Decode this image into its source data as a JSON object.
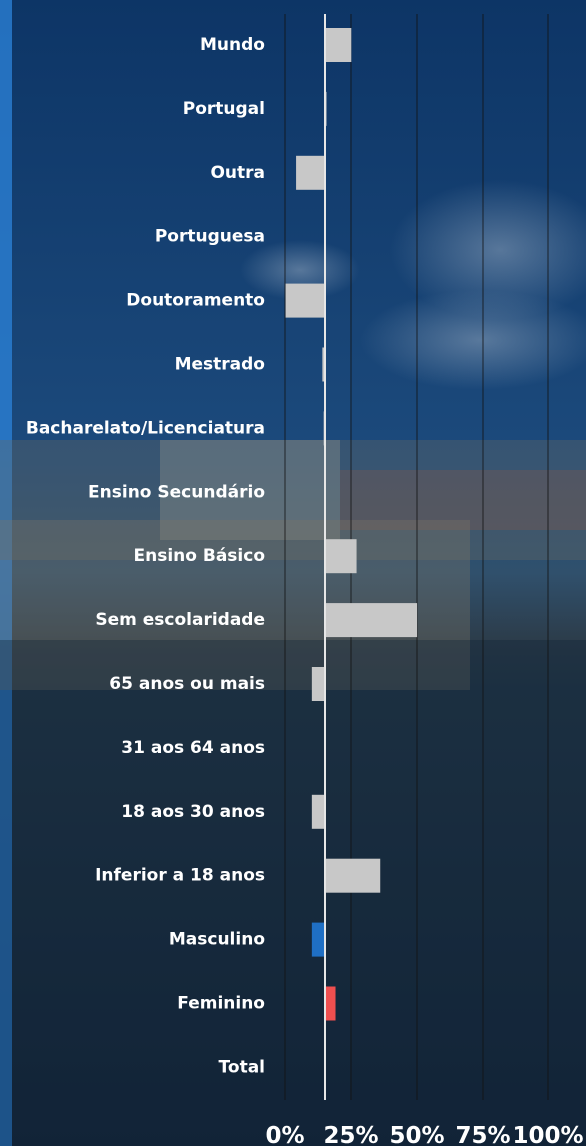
{
  "chart_data": {
    "type": "bar",
    "orientation": "horizontal",
    "categories": [
      "Mundo",
      "Portugal",
      "Outra",
      "Portuguesa",
      "Doutoramento",
      "Mestrado",
      "Bacharelato/Licenciatura",
      "Ensino Secundário",
      "Ensino Básico",
      "Sem escolaridade",
      "65 anos ou mais",
      "31 aos 64 anos",
      "18 aos 30 anos",
      "Inferior a 18 anos",
      "Masculino",
      "Feminino",
      "Total"
    ],
    "values": [
      10,
      0.5,
      -11,
      0,
      -15,
      -1,
      -0.5,
      0,
      12,
      35,
      -5,
      0,
      -5,
      21,
      -5,
      4,
      0
    ],
    "xlim": [
      0,
      100
    ],
    "xticks": [
      "0%",
      "25%",
      "50%",
      "75%",
      "100%"
    ],
    "grid": true,
    "colors": {
      "default": "#c8c8c8",
      "Masculino": "#1f6fc4",
      "Feminino": "#ef4f4f",
      "baseline": "#e6e6e6",
      "grid": "#111111"
    }
  }
}
